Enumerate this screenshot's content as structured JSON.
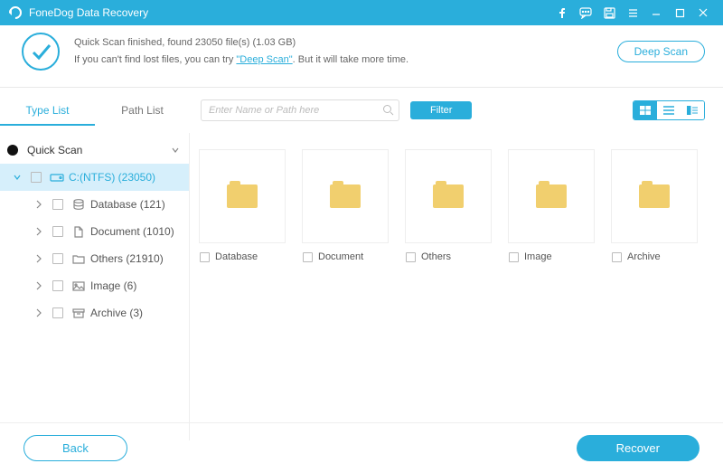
{
  "title": "FoneDog Data Recovery",
  "band": {
    "line1_prefix": "Quick Scan finished, found ",
    "file_count": "23050",
    "line1_mid": " file(s) (",
    "size": "1.03 GB",
    "line1_suffix": ")",
    "line2_prefix": "If you can't find lost files, you can try ",
    "deep_link": "\"Deep Scan\"",
    "line2_suffix": ". But it will take more time.",
    "deep_btn": "Deep Scan"
  },
  "tabs": {
    "type": "Type List",
    "path": "Path List"
  },
  "search": {
    "placeholder": "Enter Name or Path here"
  },
  "filter_btn": "Filter",
  "tree": {
    "root": "Quick Scan",
    "drive": "C:(NTFS) (23050)",
    "items": [
      {
        "label": "Database (121)"
      },
      {
        "label": "Document (1010)"
      },
      {
        "label": "Others (21910)"
      },
      {
        "label": "Image (6)"
      },
      {
        "label": "Archive (3)"
      }
    ]
  },
  "grid": {
    "items": [
      {
        "label": "Database"
      },
      {
        "label": "Document"
      },
      {
        "label": "Others"
      },
      {
        "label": "Image"
      },
      {
        "label": "Archive"
      }
    ]
  },
  "footer": {
    "back": "Back",
    "recover": "Recover"
  }
}
